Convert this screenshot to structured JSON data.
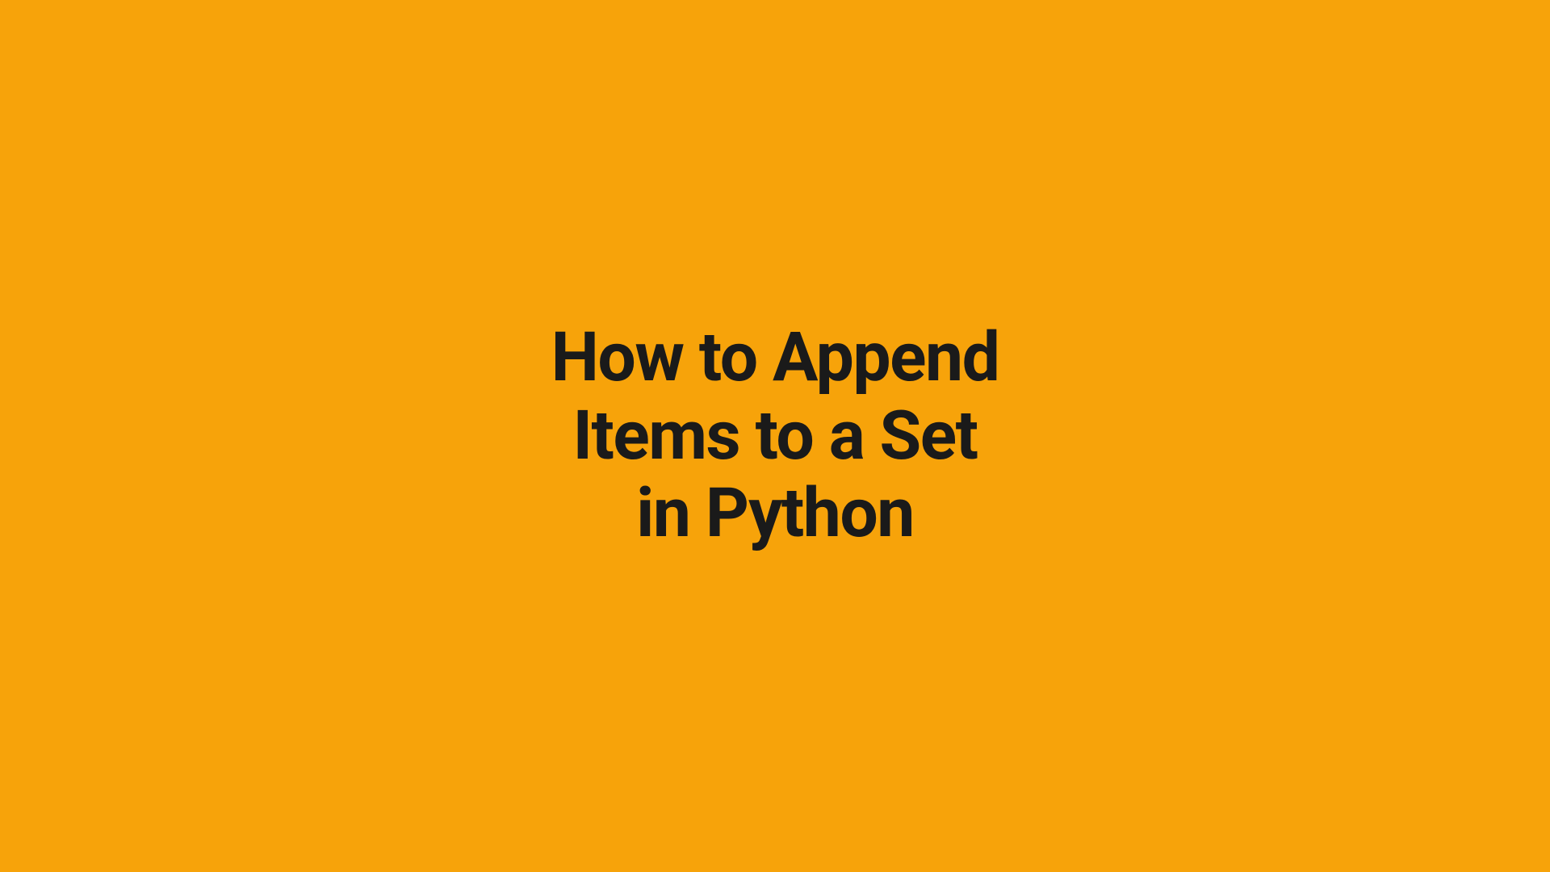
{
  "title": {
    "line1": "How to Append",
    "line2": "Items to a Set",
    "line3": "in Python"
  },
  "colors": {
    "background": "#f7a30a",
    "text": "#1a1a1a"
  }
}
